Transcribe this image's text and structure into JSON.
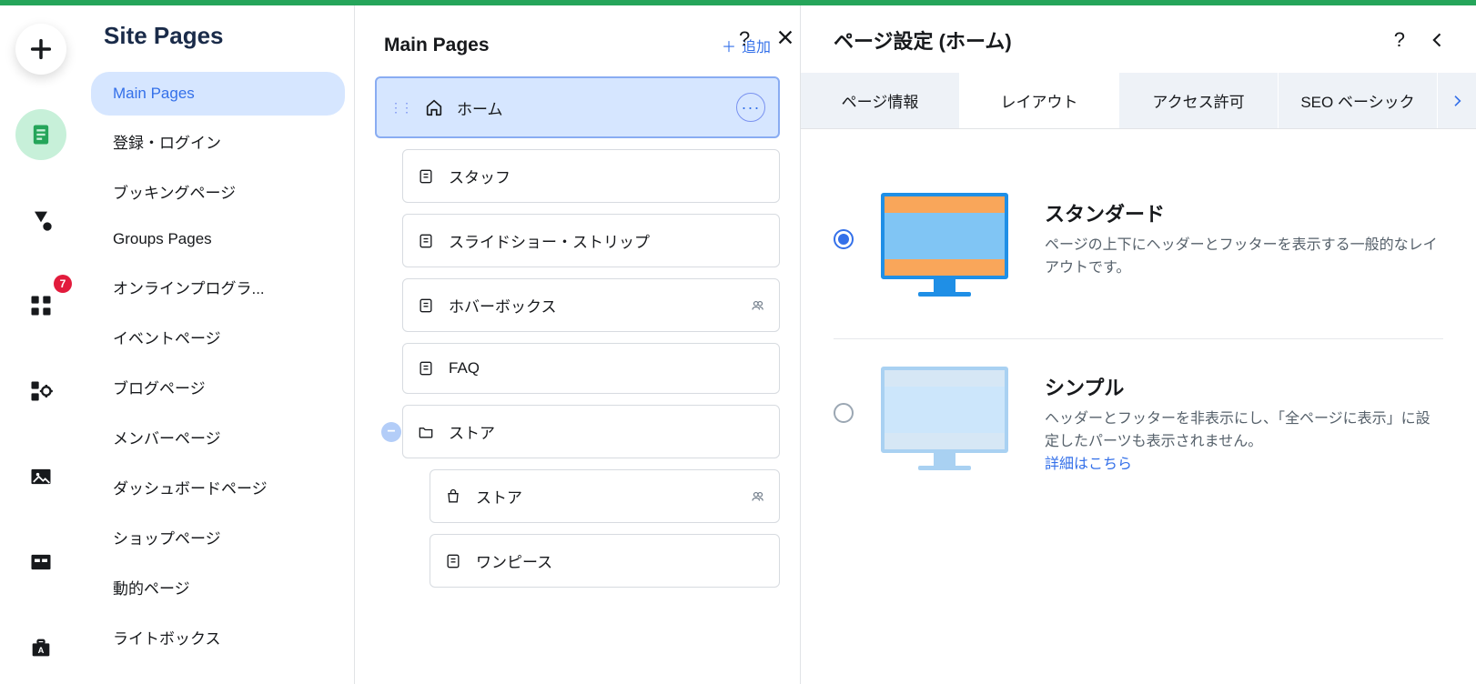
{
  "rail": {
    "badge": "7"
  },
  "panel1": {
    "title": "Site Pages",
    "categories": [
      {
        "label": "Main Pages",
        "active": true
      },
      {
        "label": "登録・ログイン"
      },
      {
        "label": "ブッキングページ"
      },
      {
        "label": "Groups Pages"
      },
      {
        "label": "オンラインプログラ..."
      },
      {
        "label": "イベントページ"
      },
      {
        "label": "ブログページ"
      },
      {
        "label": "メンバーページ"
      },
      {
        "label": "ダッシュボードページ"
      },
      {
        "label": "ショップページ"
      },
      {
        "label": "動的ページ"
      },
      {
        "label": "ライトボックス"
      }
    ]
  },
  "panel2": {
    "title": "Main Pages",
    "add_label": "追加",
    "pages": {
      "home": "ホーム",
      "staff": "スタッフ",
      "slideshow": "スライドショー・ストリップ",
      "hoverbox": "ホバーボックス",
      "faq": "FAQ",
      "store_folder": "ストア",
      "store": "ストア",
      "onepiece": "ワンピース"
    }
  },
  "panel3": {
    "title": "ページ設定 (ホーム)",
    "tabs": [
      "ページ情報",
      "レイアウト",
      "アクセス許可",
      "SEO ベーシック"
    ],
    "layouts": {
      "standard": {
        "name": "スタンダード",
        "desc": "ページの上下にヘッダーとフッターを表示する一般的なレイアウトです。"
      },
      "simple": {
        "name": "シンプル",
        "desc": "ヘッダーとフッターを非表示にし、「全ページに表示」に設定したパーツも表示されません。",
        "link": "詳細はこちら"
      }
    }
  }
}
